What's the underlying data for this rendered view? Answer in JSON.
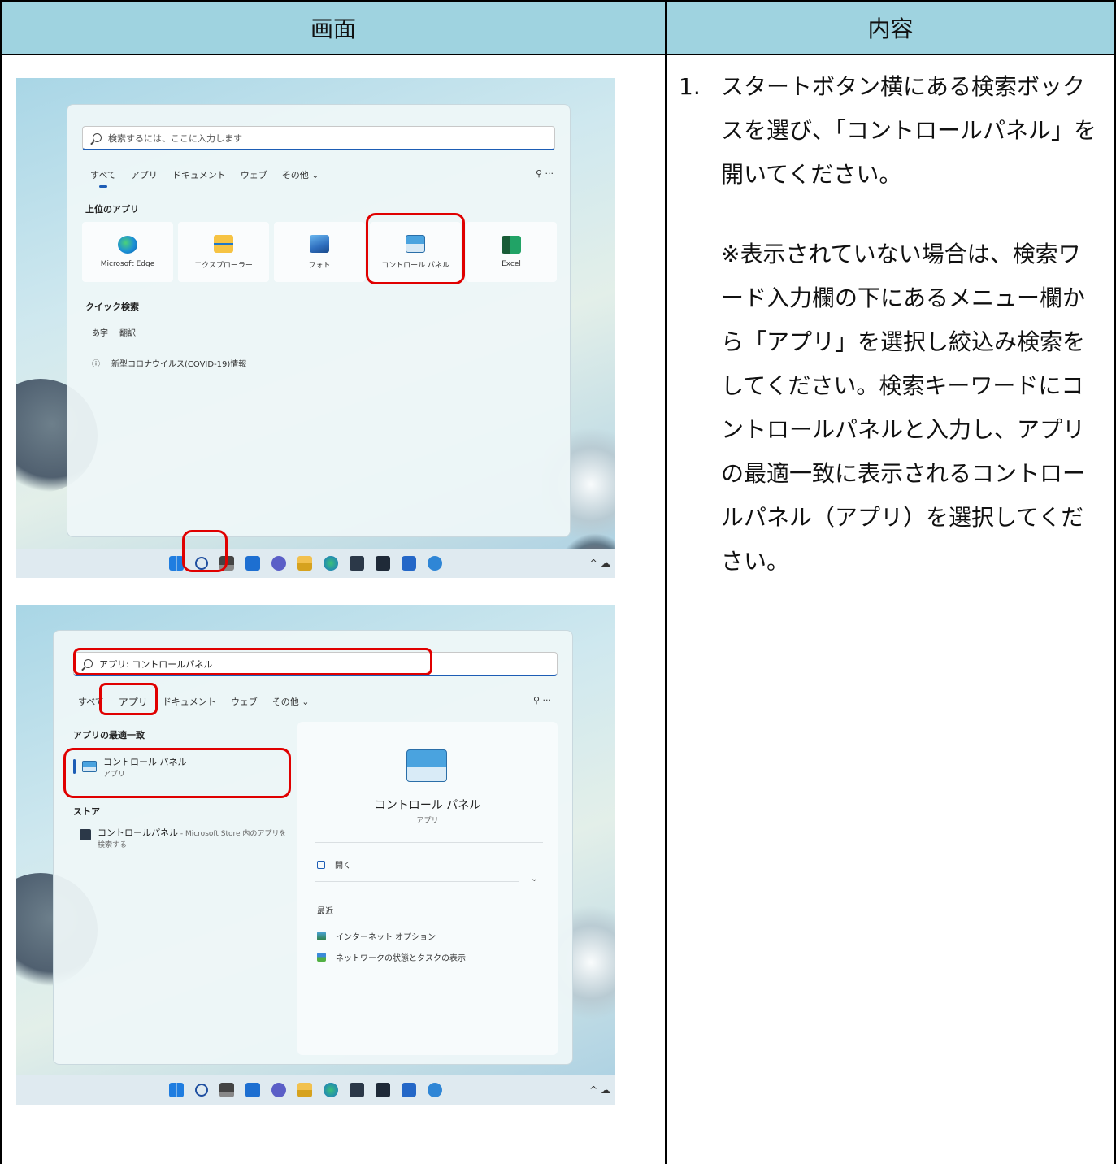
{
  "table": {
    "header_left": "画面",
    "header_right": "内容"
  },
  "instructions": {
    "number": "1.",
    "main": "スタートボタン横にある検索ボックスを選び、「コントロールパネル」を開いてください。",
    "note": "※表示されていない場合は、検索ワード入力欄の下にあるメニュー欄から「アプリ」を選択し絞込み検索をしてください。検索キーワードにコントロールパネルと入力し、アプリの最適一致に表示されるコントロールパネル（アプリ）を選択してください。"
  },
  "screen1": {
    "search_placeholder": "検索するには、ここに入力します",
    "tabs": [
      "すべて",
      "アプリ",
      "ドキュメント",
      "ウェブ",
      "その他 ⌄"
    ],
    "tab_extra": "⚲  ···",
    "top_apps_label": "上位のアプリ",
    "apps": [
      {
        "label": "Microsoft Edge",
        "icon": "edge-icon"
      },
      {
        "label": "エクスプローラー",
        "icon": "file-explorer-icon"
      },
      {
        "label": "フォト",
        "icon": "photos-icon"
      },
      {
        "label": "コントロール パネル",
        "icon": "control-panel-icon"
      },
      {
        "label": "Excel",
        "icon": "excel-icon"
      }
    ],
    "quick_label": "クイック検索",
    "quick_items": [
      {
        "icon": "あ字",
        "label": "翻訳"
      },
      {
        "icon": "ⓘ",
        "label": "新型コロナウイルス(COVID-19)情報"
      }
    ],
    "tray": "^ ☁"
  },
  "screen2": {
    "search_value": "アプリ: コントロールパネル",
    "tabs": [
      "すべて",
      "アプリ",
      "ドキュメント",
      "ウェブ",
      "その他 ⌄"
    ],
    "tab_extra": "⚲  ···",
    "best_match_label": "アプリの最適一致",
    "best_match_title": "コントロール パネル",
    "best_match_sub": "アプリ",
    "store_label": "ストア",
    "store_item": "コントロールパネル",
    "store_item_sub": " - Microsoft Store 内のアプリを検索する",
    "detail_title": "コントロール パネル",
    "detail_sub": "アプリ",
    "open_label": "開く",
    "recent_label": "最近",
    "recent_items": [
      "インターネット オプション",
      "ネットワークの状態とタスクの表示"
    ],
    "tray": "^ ☁"
  },
  "highlight_color": "#e00000",
  "header_color": "#9fd3e0"
}
